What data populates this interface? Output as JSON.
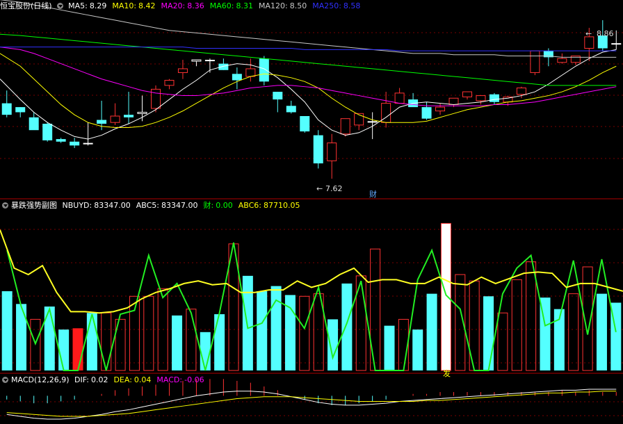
{
  "panels": {
    "main": {
      "title": "恒宝股份(日线)",
      "ma": [
        {
          "label": "MA5:",
          "value": "8.29",
          "color": "#ffffff"
        },
        {
          "label": "MA10:",
          "value": "8.42",
          "color": "#ffff00"
        },
        {
          "label": "MA20:",
          "value": "8.36",
          "color": "#ff00ff"
        },
        {
          "label": "MA60:",
          "value": "8.31",
          "color": "#00ff00"
        },
        {
          "label": "MA120:",
          "value": "8.50",
          "color": "#c8c8c8"
        },
        {
          "label": "MA250:",
          "value": "8.58",
          "color": "#3030ff"
        }
      ],
      "high_label": "8.86",
      "low_label": "7.62",
      "marker_text": "财"
    },
    "sub": {
      "title": "暴跌强势副图",
      "items": [
        {
          "label": "NBUYD:",
          "value": "83347.00",
          "color": "#ffffff"
        },
        {
          "label": "ABC5:",
          "value": "83347.00",
          "color": "#ffffff"
        },
        {
          "label": "财:",
          "value": "0.00",
          "color": "#00ff00"
        },
        {
          "label": "ABC6:",
          "value": "87710.05",
          "color": "#ffff00"
        }
      ],
      "bottom_marker": "发"
    },
    "macd": {
      "title": "MACD(12,26,9)",
      "items": [
        {
          "label": "DIF:",
          "value": "0.02",
          "color": "#ffffff"
        },
        {
          "label": "DEA:",
          "value": "0.04",
          "color": "#ffff00"
        },
        {
          "label": "MACD:",
          "value": "-0.06",
          "color": "#ff00ff"
        }
      ]
    }
  },
  "chart_data": [
    {
      "type": "candlestick",
      "ohlc": [
        [
          8.21,
          8.31,
          8.12,
          8.1
        ],
        [
          8.18,
          8.18,
          8.14,
          8.1
        ],
        [
          8.1,
          8.14,
          8.0,
          8.05
        ],
        [
          8.05,
          8.06,
          7.92,
          7.91
        ],
        [
          7.93,
          7.94,
          7.91,
          7.9
        ],
        [
          7.91,
          7.94,
          7.88,
          7.86
        ],
        [
          7.9,
          8.06,
          7.9,
          7.88
        ],
        [
          8.08,
          8.23,
          8.05,
          8.0
        ],
        [
          8.06,
          8.21,
          8.11,
          8.04
        ],
        [
          8.12,
          8.3,
          8.1,
          8.05
        ],
        [
          8.13,
          8.27,
          8.14,
          8.07
        ],
        [
          8.17,
          8.35,
          8.32,
          8.14
        ],
        [
          8.35,
          8.4,
          8.39,
          8.32
        ],
        [
          8.45,
          8.55,
          8.48,
          8.4
        ],
        [
          8.54,
          8.54,
          8.55,
          8.5
        ],
        [
          8.55,
          8.56,
          8.54,
          8.45
        ],
        [
          8.52,
          8.56,
          8.47,
          8.47
        ],
        [
          8.44,
          8.49,
          8.39,
          8.32
        ],
        [
          8.42,
          8.56,
          8.48,
          8.38
        ],
        [
          8.56,
          8.58,
          8.38,
          8.35
        ],
        [
          8.3,
          8.3,
          8.24,
          8.14
        ],
        [
          8.19,
          8.23,
          8.14,
          8.13
        ],
        [
          8.11,
          8.11,
          7.99,
          7.98
        ],
        [
          7.96,
          8.0,
          7.74,
          7.7
        ],
        [
          7.76,
          7.97,
          7.9,
          7.62
        ],
        [
          7.97,
          8.03,
          8.09,
          7.95
        ],
        [
          8.04,
          8.1,
          8.13,
          8.0
        ],
        [
          8.07,
          8.14,
          8.07,
          7.93
        ],
        [
          8.06,
          8.3,
          8.21,
          8.02
        ],
        [
          8.21,
          8.33,
          8.29,
          8.24
        ],
        [
          8.24,
          8.29,
          8.18,
          8.2
        ],
        [
          8.18,
          8.22,
          8.09,
          8.08
        ],
        [
          8.15,
          8.21,
          8.18,
          8.12
        ],
        [
          8.2,
          8.23,
          8.25,
          8.18
        ],
        [
          8.26,
          8.28,
          8.3,
          8.24
        ],
        [
          8.23,
          8.26,
          8.27,
          8.2
        ],
        [
          8.28,
          8.29,
          8.22,
          8.2
        ],
        [
          8.22,
          8.27,
          8.26,
          8.19
        ],
        [
          8.28,
          8.34,
          8.33,
          8.25
        ],
        [
          8.45,
          8.49,
          8.62,
          8.43
        ],
        [
          8.62,
          8.64,
          8.57,
          8.5
        ],
        [
          8.53,
          8.6,
          8.56,
          8.52
        ],
        [
          8.53,
          8.56,
          8.58,
          8.51
        ],
        [
          8.64,
          8.8,
          8.73,
          8.54
        ],
        [
          8.74,
          8.86,
          8.64,
          8.62
        ],
        [
          8.68,
          8.78,
          8.67,
          8.63
        ]
      ],
      "ma": {
        "MA5": [
          8.4,
          8.24,
          8.14,
          8.06,
          8.0,
          7.95,
          7.93,
          7.96,
          8.01,
          8.05,
          8.1,
          8.16,
          8.24,
          8.32,
          8.39,
          8.47,
          8.5,
          8.52,
          8.51,
          8.48,
          8.41,
          8.32,
          8.22,
          8.08,
          8.0,
          7.96,
          7.98,
          8.03,
          8.1,
          8.18,
          8.21,
          8.22,
          8.21,
          8.2,
          8.21,
          8.22,
          8.24,
          8.25,
          8.27,
          8.3,
          8.36,
          8.43,
          8.5,
          8.56,
          8.61,
          8.63
        ],
        "MA10": [
          8.6,
          8.5,
          8.4,
          8.3,
          8.2,
          8.12,
          8.06,
          8.03,
          8.02,
          8.02,
          8.03,
          8.06,
          8.1,
          8.15,
          8.21,
          8.27,
          8.33,
          8.38,
          8.42,
          8.44,
          8.43,
          8.41,
          8.38,
          8.33,
          8.25,
          8.18,
          8.12,
          8.08,
          8.06,
          8.06,
          8.06,
          8.07,
          8.1,
          8.13,
          8.16,
          8.18,
          8.2,
          8.22,
          8.23,
          8.25,
          8.27,
          8.3,
          8.34,
          8.39,
          8.45,
          8.5
        ],
        "MA20": [
          8.65,
          8.63,
          8.6,
          8.56,
          8.52,
          8.48,
          8.44,
          8.4,
          8.37,
          8.34,
          8.31,
          8.29,
          8.28,
          8.27,
          8.27,
          8.28,
          8.29,
          8.31,
          8.33,
          8.34,
          8.35,
          8.35,
          8.34,
          8.33,
          8.31,
          8.29,
          8.27,
          8.25,
          8.23,
          8.21,
          8.2,
          8.19,
          8.19,
          8.19,
          8.19,
          8.19,
          8.2,
          8.2,
          8.21,
          8.22,
          8.24,
          8.26,
          8.28,
          8.3,
          8.32,
          8.34
        ],
        "MA60": [
          8.75,
          8.74,
          8.73,
          8.72,
          8.71,
          8.7,
          8.69,
          8.68,
          8.67,
          8.66,
          8.65,
          8.64,
          8.63,
          8.62,
          8.61,
          8.6,
          8.59,
          8.58,
          8.57,
          8.56,
          8.55,
          8.54,
          8.53,
          8.52,
          8.51,
          8.5,
          8.49,
          8.48,
          8.47,
          8.46,
          8.45,
          8.44,
          8.43,
          8.42,
          8.41,
          8.4,
          8.39,
          8.38,
          8.37,
          8.36,
          8.35,
          8.35,
          8.35,
          8.35,
          8.35,
          8.35
        ],
        "MA120": [
          9.02,
          9.0,
          8.98,
          8.96,
          8.94,
          8.92,
          8.9,
          8.88,
          8.86,
          8.84,
          8.82,
          8.8,
          8.78,
          8.77,
          8.76,
          8.75,
          8.74,
          8.73,
          8.72,
          8.71,
          8.7,
          8.69,
          8.68,
          8.67,
          8.66,
          8.65,
          8.64,
          8.63,
          8.62,
          8.61,
          8.6,
          8.6,
          8.6,
          8.59,
          8.59,
          8.59,
          8.59,
          8.58,
          8.58,
          8.58,
          8.58,
          8.57,
          8.57,
          8.57,
          8.57,
          8.57
        ],
        "MA250": [
          8.65,
          8.65,
          8.65,
          8.65,
          8.65,
          8.65,
          8.65,
          8.65,
          8.65,
          8.65,
          8.65,
          8.65,
          8.65,
          8.65,
          8.64,
          8.64,
          8.64,
          8.64,
          8.64,
          8.64,
          8.64,
          8.64,
          8.63,
          8.63,
          8.63,
          8.63,
          8.63,
          8.63,
          8.63,
          8.62,
          8.62,
          8.62,
          8.62,
          8.62,
          8.62,
          8.62,
          8.62,
          8.62,
          8.62,
          8.62,
          8.62,
          8.62,
          8.62,
          8.62,
          8.62,
          8.62
        ]
      },
      "ylim": [
        7.55,
        8.92
      ]
    },
    {
      "type": "bar",
      "bars": [
        {
          "v": 62,
          "s": "c"
        },
        {
          "v": 52,
          "s": "c"
        },
        {
          "v": 40,
          "s": "r"
        },
        {
          "v": 50,
          "s": "c"
        },
        {
          "v": 32,
          "s": "c"
        },
        {
          "v": 33,
          "s": "f"
        },
        {
          "v": 45,
          "s": "c"
        },
        {
          "v": 45,
          "s": "r"
        },
        {
          "v": 40,
          "s": "r"
        },
        {
          "v": 58,
          "s": "r"
        },
        {
          "v": 58,
          "s": "r"
        },
        {
          "v": 64,
          "s": "r"
        },
        {
          "v": 43,
          "s": "c"
        },
        {
          "v": 48,
          "s": "r"
        },
        {
          "v": 30,
          "s": "c"
        },
        {
          "v": 44,
          "s": "c"
        },
        {
          "v": 99,
          "s": "r"
        },
        {
          "v": 74,
          "s": "c"
        },
        {
          "v": 62,
          "s": "c"
        },
        {
          "v": 66,
          "s": "c"
        },
        {
          "v": 59,
          "s": "c"
        },
        {
          "v": 58,
          "s": "r"
        },
        {
          "v": 60,
          "s": "r"
        },
        {
          "v": 40,
          "s": "c"
        },
        {
          "v": 68,
          "s": "c"
        },
        {
          "v": 74,
          "s": "r"
        },
        {
          "v": 95,
          "s": "r"
        },
        {
          "v": 35,
          "s": "c"
        },
        {
          "v": 40,
          "s": "r"
        },
        {
          "v": 32,
          "s": "c"
        },
        {
          "v": 60,
          "s": "c"
        },
        {
          "v": 115,
          "s": "w"
        },
        {
          "v": 75,
          "s": "r"
        },
        {
          "v": 70,
          "s": "r"
        },
        {
          "v": 58,
          "s": "c"
        },
        {
          "v": 45,
          "s": "r"
        },
        {
          "v": 71,
          "s": "r"
        },
        {
          "v": 85,
          "s": "r"
        },
        {
          "v": 57,
          "s": "c"
        },
        {
          "v": 48,
          "s": "c"
        },
        {
          "v": 60,
          "s": "r"
        },
        {
          "v": 81,
          "s": "r"
        },
        {
          "v": 60,
          "s": "c"
        },
        {
          "v": 53,
          "s": "c"
        }
      ],
      "green": [
        94,
        50,
        21,
        48,
        0,
        0,
        44,
        0,
        44,
        47,
        90,
        57,
        68,
        45,
        0,
        45,
        100,
        33,
        37,
        55,
        49,
        33,
        65,
        10,
        37,
        70,
        0,
        0,
        0,
        71,
        94,
        59,
        48,
        0,
        0,
        60,
        80,
        90,
        35,
        40,
        86,
        28,
        87,
        30
      ],
      "yellow": [
        110,
        80,
        75,
        82,
        61,
        46,
        46,
        45,
        46,
        49,
        56,
        61,
        64,
        68,
        70,
        67,
        68,
        61,
        61,
        63,
        63,
        70,
        65,
        68,
        75,
        80,
        69,
        71,
        71,
        68,
        68,
        73,
        68,
        67,
        73,
        68,
        72,
        76,
        77,
        76,
        65,
        68,
        68,
        65,
        62
      ],
      "ylim": [
        0,
        125
      ]
    },
    {
      "type": "line",
      "dif": [
        -0.2,
        -0.22,
        -0.24,
        -0.25,
        -0.25,
        -0.24,
        -0.22,
        -0.2,
        -0.17,
        -0.15,
        -0.12,
        -0.09,
        -0.06,
        -0.03,
        0.0,
        0.02,
        0.04,
        0.05,
        0.05,
        0.04,
        0.02,
        -0.01,
        -0.04,
        -0.07,
        -0.09,
        -0.1,
        -0.1,
        -0.09,
        -0.08,
        -0.06,
        -0.05,
        -0.04,
        -0.03,
        -0.02,
        -0.01,
        0.0,
        0.01,
        0.02,
        0.03,
        0.04,
        0.05,
        0.06,
        0.06,
        0.07,
        0.07,
        0.07
      ],
      "dea": [
        -0.18,
        -0.19,
        -0.2,
        -0.21,
        -0.22,
        -0.22,
        -0.22,
        -0.21,
        -0.2,
        -0.19,
        -0.17,
        -0.15,
        -0.13,
        -0.11,
        -0.09,
        -0.07,
        -0.05,
        -0.03,
        -0.02,
        -0.01,
        -0.01,
        -0.01,
        -0.02,
        -0.03,
        -0.04,
        -0.05,
        -0.06,
        -0.06,
        -0.06,
        -0.06,
        -0.06,
        -0.05,
        -0.05,
        -0.04,
        -0.03,
        -0.02,
        -0.01,
        0.0,
        0.01,
        0.02,
        0.03,
        0.03,
        0.04,
        0.04,
        0.05,
        0.05
      ],
      "ylim": [
        -0.28,
        0.1
      ]
    }
  ]
}
